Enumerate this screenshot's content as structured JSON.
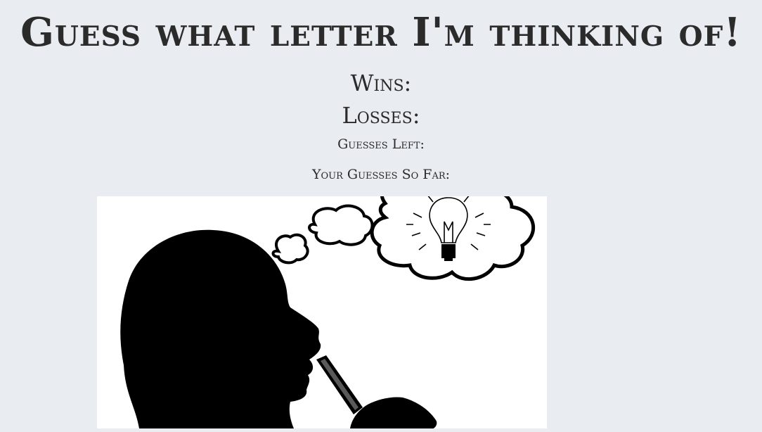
{
  "header": {
    "title": "Guess what letter I'm thinking of!"
  },
  "stats": {
    "wins_label": "Wins:",
    "losses_label": "Losses:",
    "guesses_left_label": "Guesses Left:",
    "guesses_so_far_label": "Your Guesses So Far:"
  },
  "illustration": {
    "icon": "thinking-person-lightbulb-icon"
  },
  "colors": {
    "background": "#e9ecf1",
    "text": "#2b2b2b",
    "silhouette": "#000000",
    "illustration_bg": "#ffffff"
  }
}
